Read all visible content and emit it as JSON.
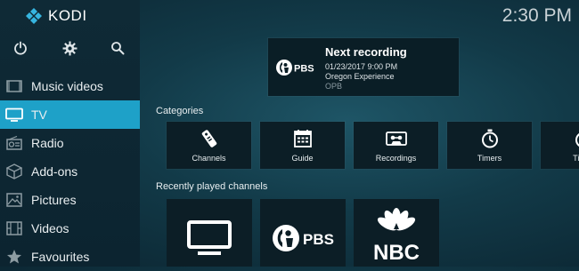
{
  "app": {
    "brand": "KODI",
    "clock": "2:30 PM"
  },
  "sidebar": {
    "top_icons": [
      "power-icon",
      "gear-icon",
      "search-icon"
    ],
    "items": [
      {
        "label": "Music videos",
        "icon": "music-video-icon",
        "active": false
      },
      {
        "label": "TV",
        "icon": "tv-icon",
        "active": true
      },
      {
        "label": "Radio",
        "icon": "radio-icon",
        "active": false
      },
      {
        "label": "Add-ons",
        "icon": "addons-box-icon",
        "active": false
      },
      {
        "label": "Pictures",
        "icon": "pictures-icon",
        "active": false
      },
      {
        "label": "Videos",
        "icon": "film-icon",
        "active": false
      },
      {
        "label": "Favourites",
        "icon": "star-icon",
        "active": false
      }
    ]
  },
  "recording": {
    "title": "Next recording",
    "datetime": "01/23/2017 9:00 PM",
    "program": "Oregon Experience",
    "channel": "OPB",
    "logo_text": "PBS"
  },
  "categories": {
    "title": "Categories",
    "items": [
      {
        "label": "Channels",
        "icon": "remote-icon"
      },
      {
        "label": "Guide",
        "icon": "guide-icon"
      },
      {
        "label": "Recordings",
        "icon": "cassette-icon"
      },
      {
        "label": "Timers",
        "icon": "timer-icon"
      },
      {
        "label": "Timer",
        "icon": "timer-icon"
      }
    ]
  },
  "recent": {
    "title": "Recently played channels",
    "pbs_logo_text": "PBS",
    "nbc_logo_text": "NBC"
  },
  "colors": {
    "accent": "#1ea1c8",
    "tile_bg": "#0c1e26",
    "sidebar_bg": "#0f2a36"
  }
}
